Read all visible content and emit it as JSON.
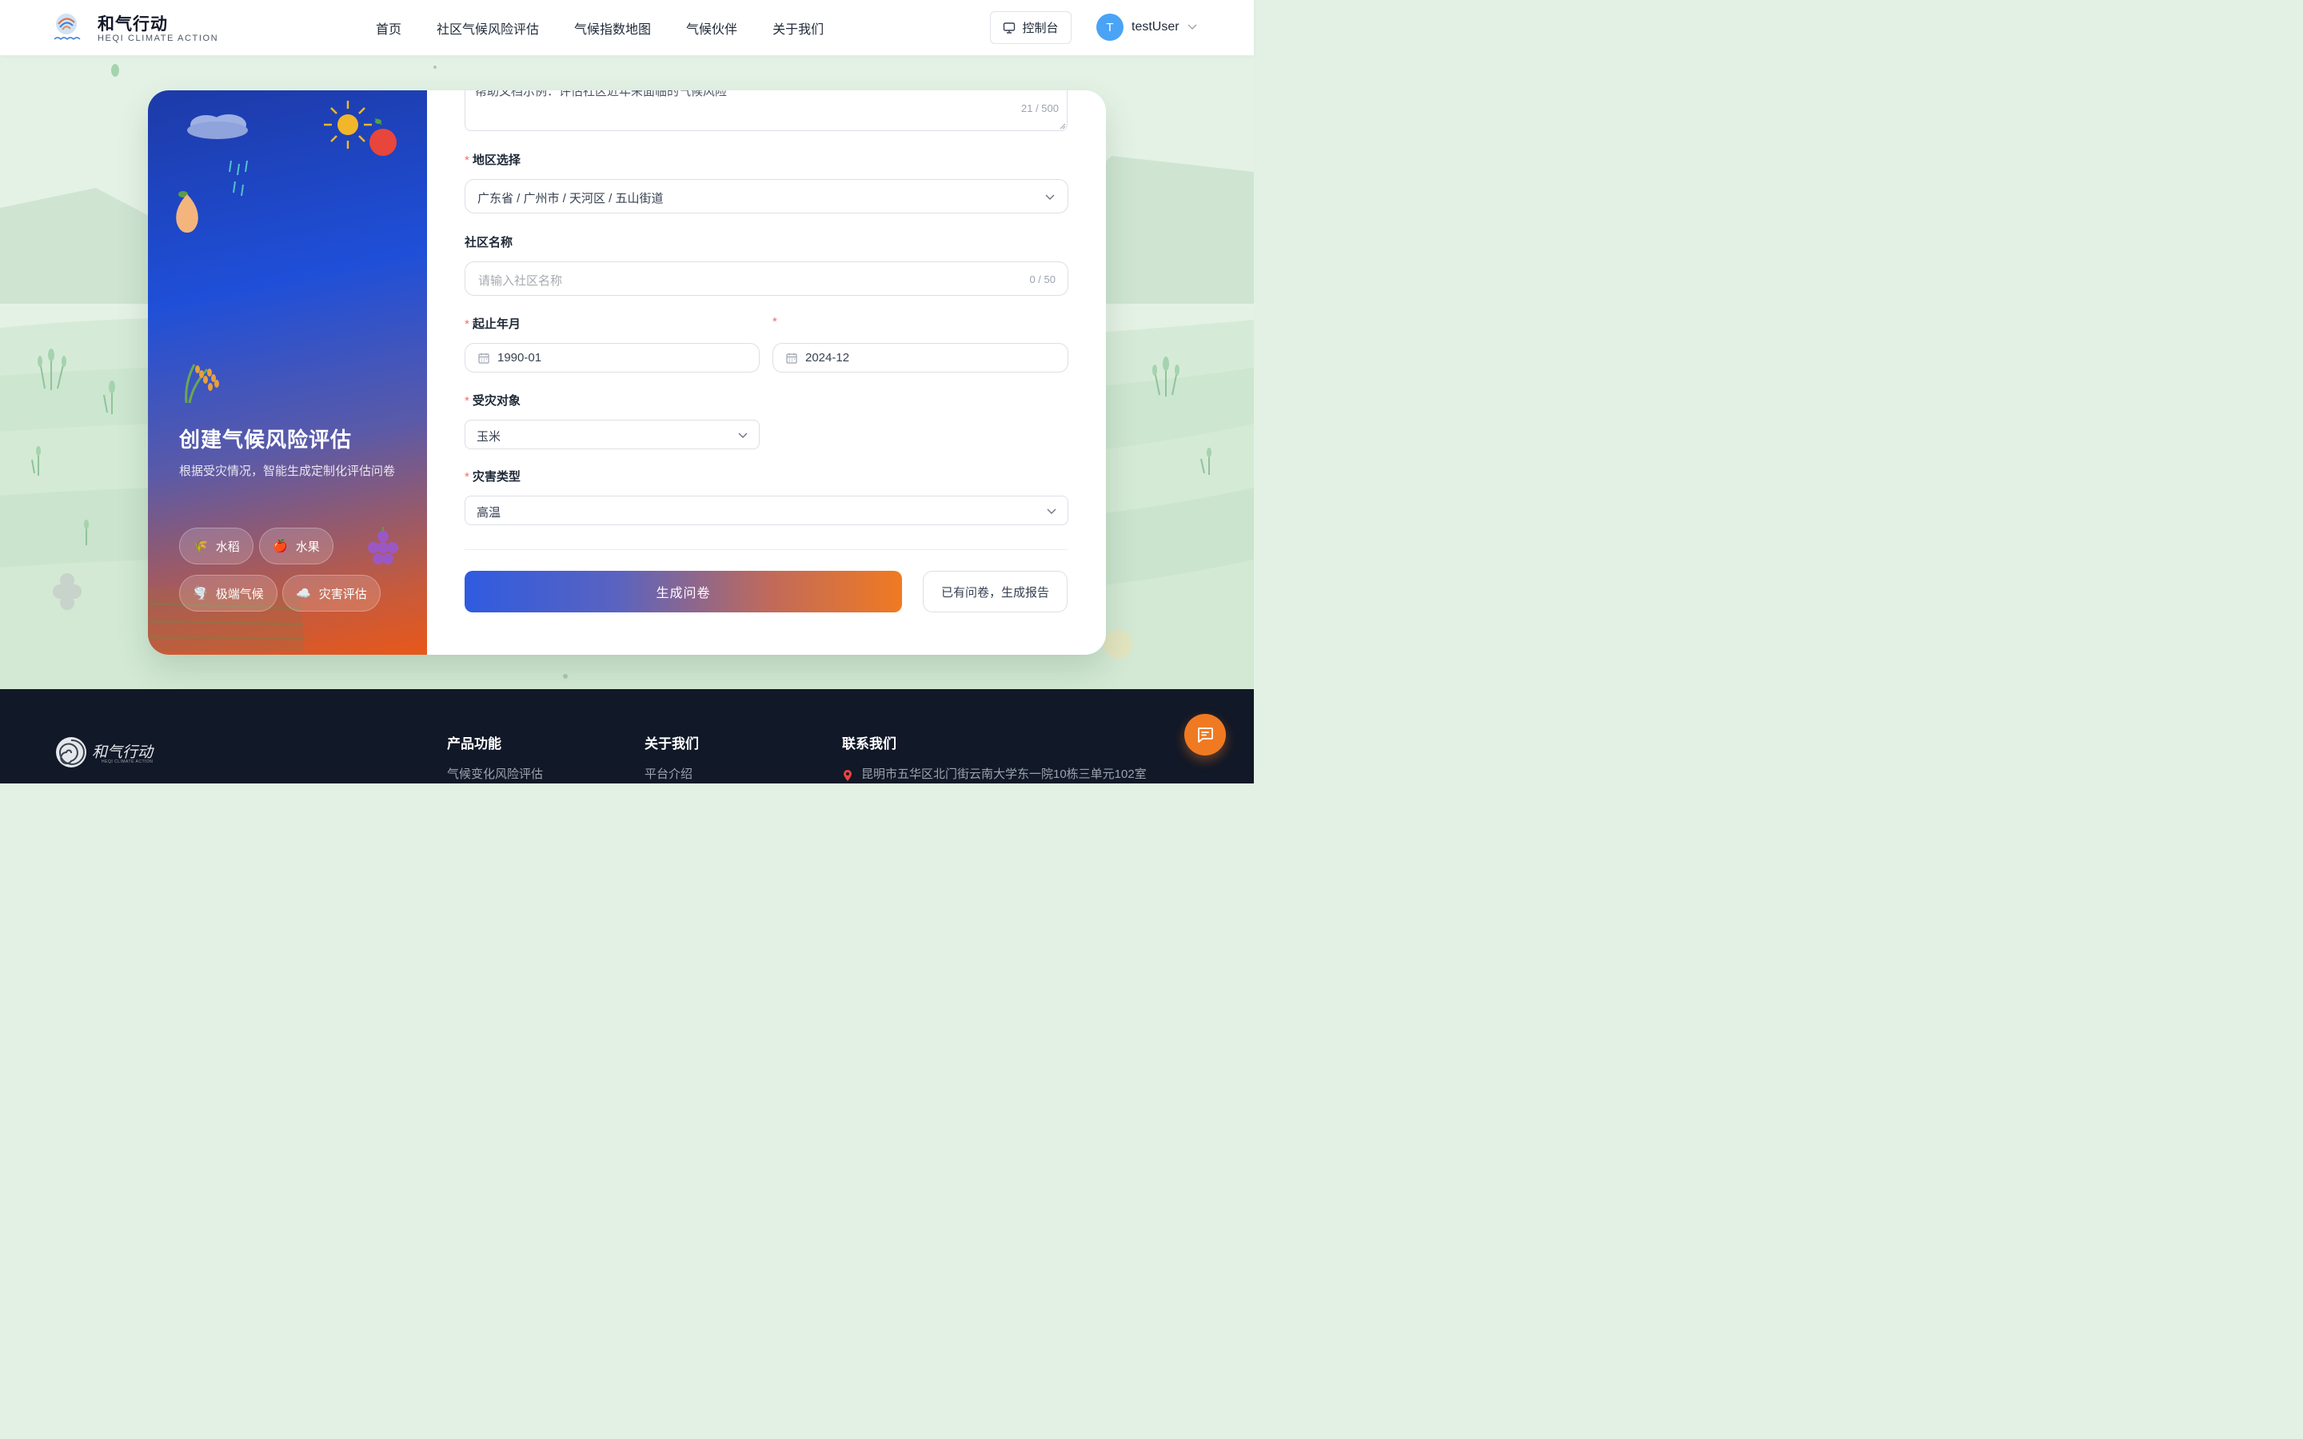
{
  "header": {
    "brand_title": "和气行动",
    "brand_subtitle": "HEQI CLIMATE ACTION",
    "nav": [
      "首页",
      "社区气候风险评估",
      "气候指数地图",
      "气候伙伴",
      "关于我们"
    ],
    "console_label": "控制台",
    "avatar_initial": "T",
    "username": "testUser"
  },
  "hero": {
    "title": "创建气候风险评估",
    "description": "根据受灾情况，智能生成定制化评估问卷",
    "chips": [
      {
        "icon": "rice-icon",
        "label": "水稻"
      },
      {
        "icon": "apple-icon",
        "label": "水果"
      },
      {
        "icon": "tornado-icon",
        "label": "极端气候"
      },
      {
        "icon": "cloud-icon",
        "label": "灾害评估"
      }
    ]
  },
  "form": {
    "description_value": "帮助文档示例：评估社区近年来面临的气候风险",
    "description_counter": "21 / 500",
    "region_label": "地区选择",
    "region_value": "广东省 / 广州市 / 天河区 / 五山街道",
    "community_label": "社区名称",
    "community_placeholder": "请输入社区名称",
    "community_counter": "0 / 50",
    "date_label": "起止年月",
    "date_start": "1990-01",
    "date_end": "2024-12",
    "target_label": "受灾对象",
    "target_value": "玉米",
    "disaster_label": "灾害类型",
    "disaster_value": "高温",
    "required_mark": "*",
    "generate_button": "生成问卷",
    "report_button": "已有问卷，生成报告"
  },
  "footer": {
    "logo_text": "和气行动",
    "logo_subtext": "HEQI CLIMATE ACTION",
    "columns": [
      {
        "heading": "产品功能",
        "first_link": "气候变化风险评估"
      },
      {
        "heading": "关于我们",
        "first_link": "平台介绍"
      },
      {
        "heading": "联系我们",
        "first_link": "昆明市五华区北门街云南大学东一院10栋三单元102室"
      }
    ]
  },
  "colors": {
    "accent_orange": "#f07a22",
    "accent_blue": "#2f5be0",
    "required_red": "#f56c6c",
    "footer_bg": "#111827"
  }
}
